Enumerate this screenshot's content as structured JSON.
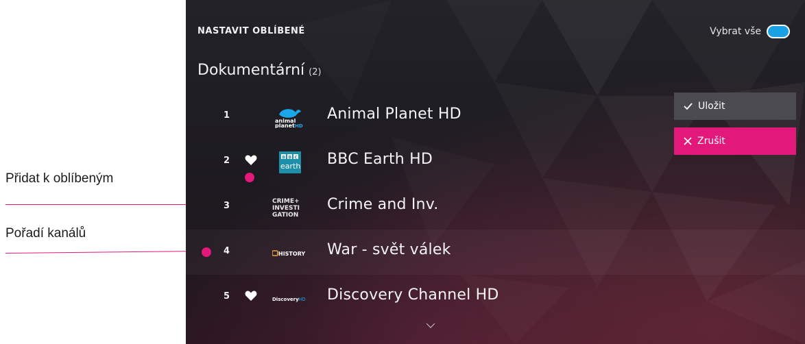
{
  "annotations": {
    "add_favorite": "Přidat k oblíbeným",
    "channel_order": "Pořadí kanálů",
    "accent": "#e2187a"
  },
  "header": {
    "title": "NASTAVIT OBLÍBENÉ",
    "select_all_label": "Vybrat vše",
    "select_all_on": true
  },
  "category": {
    "name": "Dokumentární",
    "count": "(2)"
  },
  "channels": [
    {
      "number": "1",
      "name": "Animal Planet HD",
      "favorite": false,
      "logo": "animal-planet"
    },
    {
      "number": "2",
      "name": "BBC Earth HD",
      "favorite": true,
      "logo": "bbc-earth"
    },
    {
      "number": "3",
      "name": "Crime and Inv.",
      "favorite": false,
      "logo": "crime-investigation"
    },
    {
      "number": "4",
      "name": "War - svět válek",
      "favorite": false,
      "logo": "history"
    },
    {
      "number": "5",
      "name": "Discovery Channel HD",
      "favorite": true,
      "logo": "discovery"
    }
  ],
  "logos": {
    "animal_planet_line1": "animal",
    "animal_planet_line2": "planet",
    "animal_planet_hd": "HD",
    "bbc_letters": [
      "B",
      "B",
      "C"
    ],
    "bbc_word": "earth",
    "crime_lines": [
      "CRIME+",
      "INVESTI",
      "GATION"
    ],
    "history": "HISTORY",
    "discovery": "Discovery",
    "discovery_hd": "HD"
  },
  "actions": {
    "save_label": "Uložit",
    "cancel_label": "Zrušit"
  },
  "colors": {
    "toggle": "#1aa1e4",
    "save_bg": "#4a4a50",
    "cancel_bg": "#e2187a"
  }
}
